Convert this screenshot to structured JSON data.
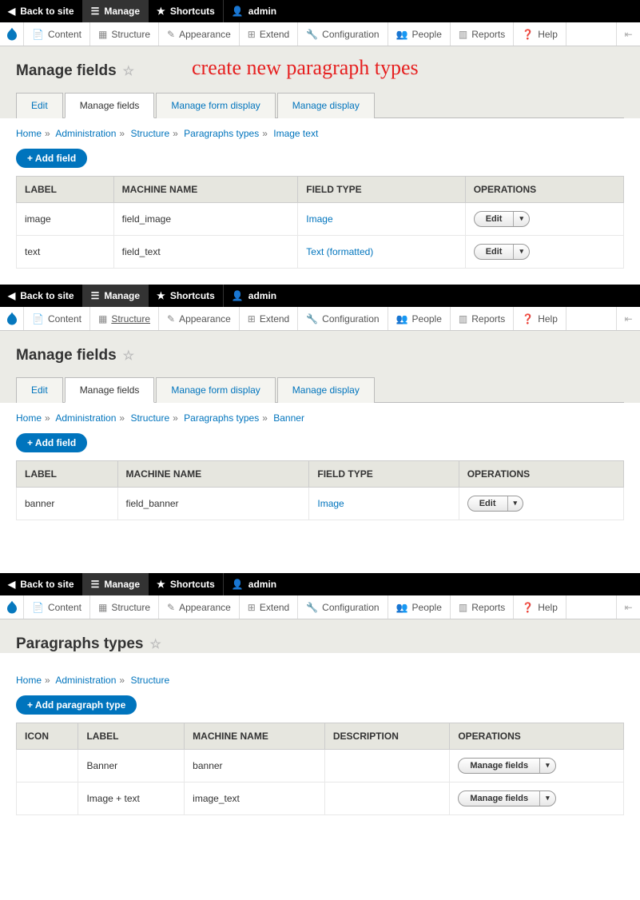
{
  "annotation": "create new paragraph types",
  "toolbar": {
    "back": "Back to site",
    "manage": "Manage",
    "shortcuts": "Shortcuts",
    "user": "admin"
  },
  "admin_menu": {
    "content": "Content",
    "structure": "Structure",
    "appearance": "Appearance",
    "extend": "Extend",
    "configuration": "Configuration",
    "people": "People",
    "reports": "Reports",
    "help": "Help"
  },
  "panel1": {
    "title": "Manage fields",
    "tabs": [
      "Edit",
      "Manage fields",
      "Manage form display",
      "Manage display"
    ],
    "active_tab": 1,
    "breadcrumb": [
      "Home",
      "Administration",
      "Structure",
      "Paragraphs types",
      "Image text"
    ],
    "add_button": "+ Add field",
    "headers": [
      "LABEL",
      "MACHINE NAME",
      "FIELD TYPE",
      "OPERATIONS"
    ],
    "rows": [
      {
        "label": "image",
        "machine": "field_image",
        "type": "Image"
      },
      {
        "label": "text",
        "machine": "field_text",
        "type": "Text (formatted)"
      }
    ],
    "op_label": "Edit"
  },
  "panel2": {
    "title": "Manage fields",
    "tabs": [
      "Edit",
      "Manage fields",
      "Manage form display",
      "Manage display"
    ],
    "active_tab": 1,
    "breadcrumb": [
      "Home",
      "Administration",
      "Structure",
      "Paragraphs types",
      "Banner"
    ],
    "add_button": "+ Add field",
    "headers": [
      "LABEL",
      "MACHINE NAME",
      "FIELD TYPE",
      "OPERATIONS"
    ],
    "rows": [
      {
        "label": "banner",
        "machine": "field_banner",
        "type": "Image"
      }
    ],
    "op_label": "Edit"
  },
  "panel3": {
    "title": "Paragraphs types",
    "breadcrumb": [
      "Home",
      "Administration",
      "Structure"
    ],
    "add_button": "+ Add paragraph type",
    "headers": [
      "ICON",
      "LABEL",
      "MACHINE NAME",
      "DESCRIPTION",
      "OPERATIONS"
    ],
    "rows": [
      {
        "icon": "",
        "label": "Banner",
        "machine": "banner",
        "description": ""
      },
      {
        "icon": "",
        "label": "Image + text",
        "machine": "image_text",
        "description": ""
      }
    ],
    "op_label": "Manage fields"
  }
}
